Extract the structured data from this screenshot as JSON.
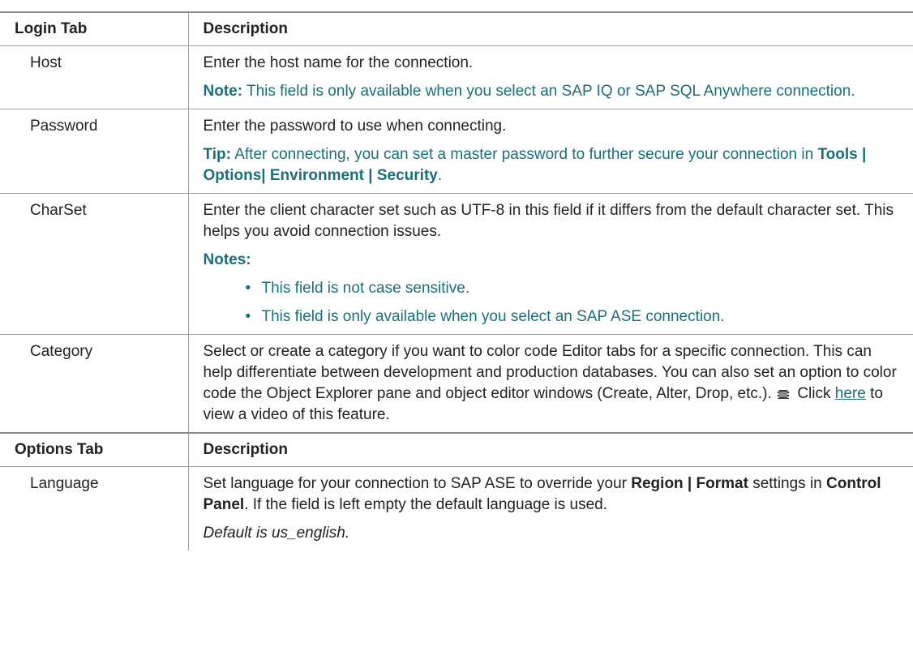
{
  "login_header": {
    "col1": "Login Tab",
    "col2": "Description"
  },
  "host": {
    "name": "Host",
    "desc": "Enter the host name for the connection.",
    "note_label": "Note:",
    "note_text": " This field is only available when you select an SAP IQ or SAP SQL Anywhere connection."
  },
  "password": {
    "name": "Password",
    "desc": "Enter the password to use when connecting.",
    "tip_label": "Tip:",
    "tip_text_1": " After connecting, you can set a master password to further secure your connection in ",
    "tip_bold": "Tools | Options| Environment | Security",
    "tip_text_2": "."
  },
  "charset": {
    "name": "CharSet",
    "desc": "Enter the client character set such as UTF-8 in this field if it differs from the default character set. This helps you avoid connection issues.",
    "notes_label": "Notes:",
    "notes": [
      "This field is not case sensitive.",
      "This field is only available when you select an SAP ASE connection."
    ]
  },
  "category": {
    "name": "Category",
    "desc_1": "Select or create a category if you want to color code Editor tabs for a specific connection. This can help differentiate between development and production databases. You can also set an option to color code the Object Explorer pane and object editor windows (Create, Alter, Drop, etc.).",
    "desc_2": " Click ",
    "link": "here",
    "desc_3": " to view a video of this feature.",
    "icon": "video-icon"
  },
  "options_header": {
    "col1": "Options Tab",
    "col2": "Description"
  },
  "language": {
    "name": "Language",
    "desc_1": "Set language for your connection to SAP ASE to override your ",
    "bold_1": "Region | Format",
    "desc_2": " settings in ",
    "bold_2": "Control Panel",
    "desc_3": ". If the field is left empty the default language is used.",
    "default": "Default is us_english."
  },
  "colors": {
    "note": "#1a6f79",
    "border": "#a0a0a0"
  }
}
